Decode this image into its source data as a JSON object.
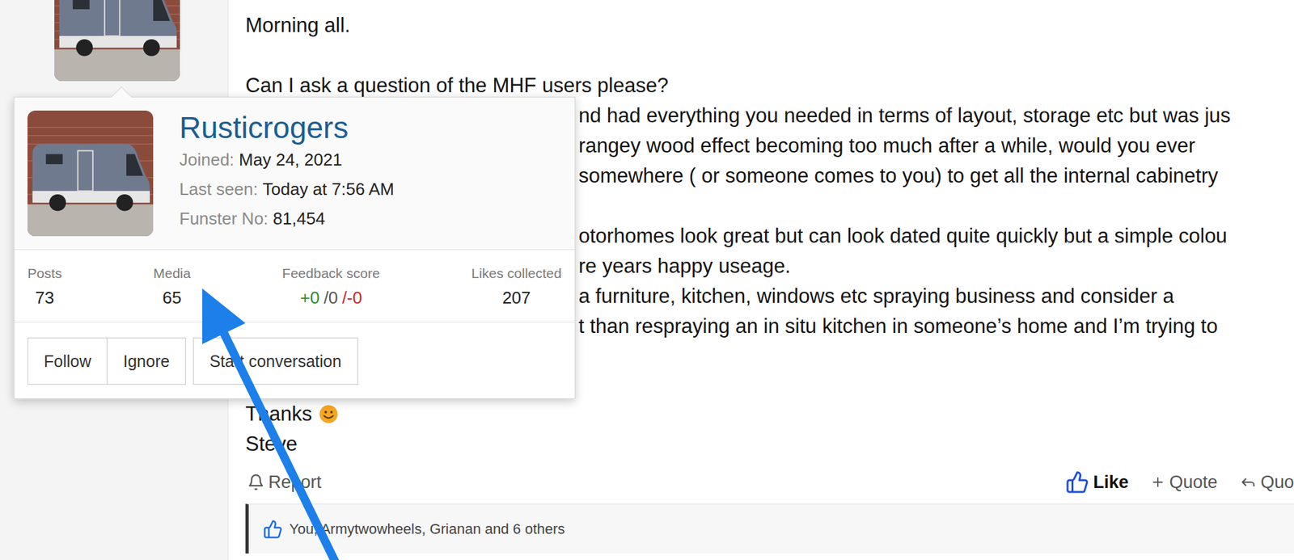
{
  "post": {
    "greeting": "Morning all.",
    "question": "Can I ask a question of the MHF users please?",
    "behind_card": [
      [
        "nd had everything you needed in terms of layout, storage etc but was jus",
        "rangey wood effect becoming too much after a while, would you ever",
        "somewhere ( or someone comes to you) to get all the internal cabinetry"
      ],
      [
        "otorhomes look great but can look dated quite quickly but a simple colou",
        "re years happy useage.",
        "a furniture, kitchen, windows etc spraying business and consider a",
        "t than respraying an in situ kitchen in someone’s home and I’m trying to"
      ]
    ],
    "thanks": "Thanks",
    "signature": "Steve"
  },
  "actions": {
    "report": "Report",
    "like": "Like",
    "liked": true,
    "quote": "Quote",
    "reply": "Quo"
  },
  "reactions": {
    "text": "You, Armytwowheels, Grianan and 6 others"
  },
  "member_card": {
    "name": "Rusticrogers",
    "details": [
      {
        "label": "Joined:",
        "value": "May 24, 2021"
      },
      {
        "label": "Last seen:",
        "value": "Today at 7:56 AM"
      },
      {
        "label": "Funster No:",
        "value": "81,454"
      }
    ],
    "stats": [
      {
        "kind": "count",
        "label": "Posts",
        "value": "73",
        "parts": []
      },
      {
        "kind": "count",
        "label": "Media",
        "value": "65",
        "parts": []
      },
      {
        "kind": "feedback",
        "label": "Feedback score",
        "value": "",
        "parts": [
          {
            "text": "+0",
            "color": "#2e8b2e"
          },
          {
            "text": "/0",
            "color": "#555555"
          },
          {
            "text": "/-0",
            "color": "#c62828"
          }
        ]
      },
      {
        "kind": "count",
        "label": "Likes collected",
        "value": "207",
        "parts": []
      }
    ],
    "button_groups": [
      [
        "Follow",
        "Ignore"
      ],
      [
        "Start conversation"
      ]
    ]
  }
}
